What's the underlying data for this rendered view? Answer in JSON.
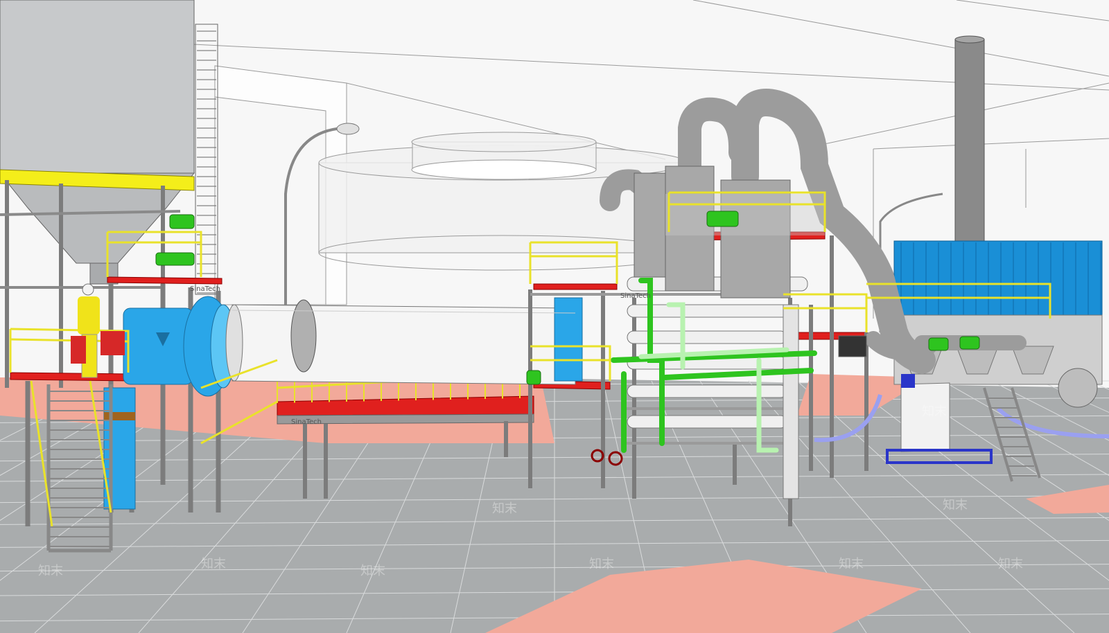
{
  "plate_labels": [
    "SinaTech",
    "SinaTech",
    "SinaTech"
  ],
  "watermark": "知末",
  "colors": {
    "floor": "#a9acad",
    "floor_line": "#d9dbdc",
    "floor_zone": "#f2a99a",
    "steel": "#b8b8b8",
    "steel_dark": "#7c7c7c",
    "handrail": "#e9e22a",
    "deck": "#e0201e",
    "fan": "#2aa6e8",
    "kiln": "#f5f5f5",
    "duct": "#9c9c9c",
    "green_pipe": "#2ec41f",
    "light_green_pipe": "#b8f2b0",
    "baghouse": "#1a8fd6",
    "silo_ring": "#f4ee1a",
    "worker": "#f0e31a",
    "valve": "#d62828",
    "frame_blue": "#2a35c9"
  },
  "icons": [
    "silo-icon",
    "rotary-kiln-icon",
    "cyclone-duct-icon",
    "baghouse-icon",
    "chimney-icon",
    "street-lamp-icon",
    "worker-icon",
    "valve-icon"
  ]
}
